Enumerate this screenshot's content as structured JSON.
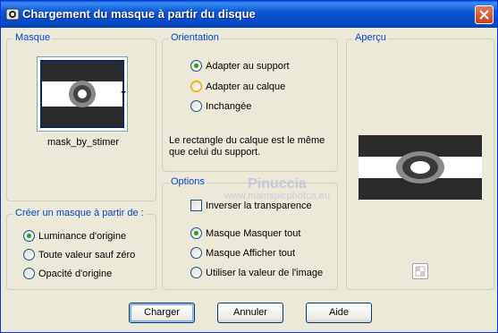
{
  "window": {
    "title": "Chargement du masque à partir du disque"
  },
  "mask_group": {
    "label": "Masque",
    "mask_name": "mask_by_stimer"
  },
  "orientation": {
    "label": "Orientation",
    "options": [
      {
        "label": "Adapter au support",
        "checked": true
      },
      {
        "label": "Adapter au calque",
        "checked": false
      },
      {
        "label": "Inchangée",
        "checked": false
      }
    ],
    "note": "Le rectangle du calque est le même que celui du support."
  },
  "create_from": {
    "label": "Créer un masque à partir de :",
    "options": [
      {
        "label": "Luminance d'origine",
        "checked": true
      },
      {
        "label": "Toute valeur sauf zéro",
        "checked": false
      },
      {
        "label": "Opacité d'origine",
        "checked": false
      }
    ]
  },
  "options": {
    "label": "Options",
    "invert_label": "Inverser la transparence",
    "invert_checked": false,
    "radios": [
      {
        "label": "Masque Masquer tout",
        "checked": true
      },
      {
        "label": "Masque Afficher tout",
        "checked": false
      },
      {
        "label": "Utiliser la valeur de l'image",
        "checked": false
      }
    ]
  },
  "preview": {
    "label": "Aperçu"
  },
  "watermark": {
    "line1": "Pinuccia",
    "line2": "www.mairispicphotca.eu"
  },
  "buttons": {
    "load": "Charger",
    "cancel": "Annuler",
    "help": "Aide"
  },
  "colors": {
    "accent": "#0046d5",
    "titlebar": "#0a57d4",
    "radio_check": "#21a121"
  }
}
